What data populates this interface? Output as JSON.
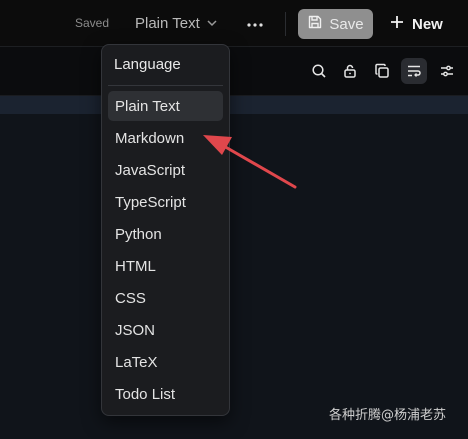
{
  "topbar": {
    "status": "Saved",
    "language_value": "Plain Text",
    "save_label": "Save",
    "new_label": "New"
  },
  "menu": {
    "heading": "Language",
    "selected": "Plain Text",
    "items": [
      "Plain Text",
      "Markdown",
      "JavaScript",
      "TypeScript",
      "Python",
      "HTML",
      "CSS",
      "JSON",
      "LaTeX",
      "Todo List"
    ]
  },
  "toolbar": {
    "icons": [
      "search-icon",
      "lock-icon",
      "copy-icon",
      "wrap-icon",
      "settings-sliders-icon"
    ],
    "active": "wrap-icon"
  },
  "watermark": "各种折腾@杨浦老苏",
  "colors": {
    "save_button_bg": "#8f8f8f",
    "menu_bg": "#1b1c1f",
    "selected_item_bg": "#2e3034",
    "arrow": "#e0474c"
  }
}
